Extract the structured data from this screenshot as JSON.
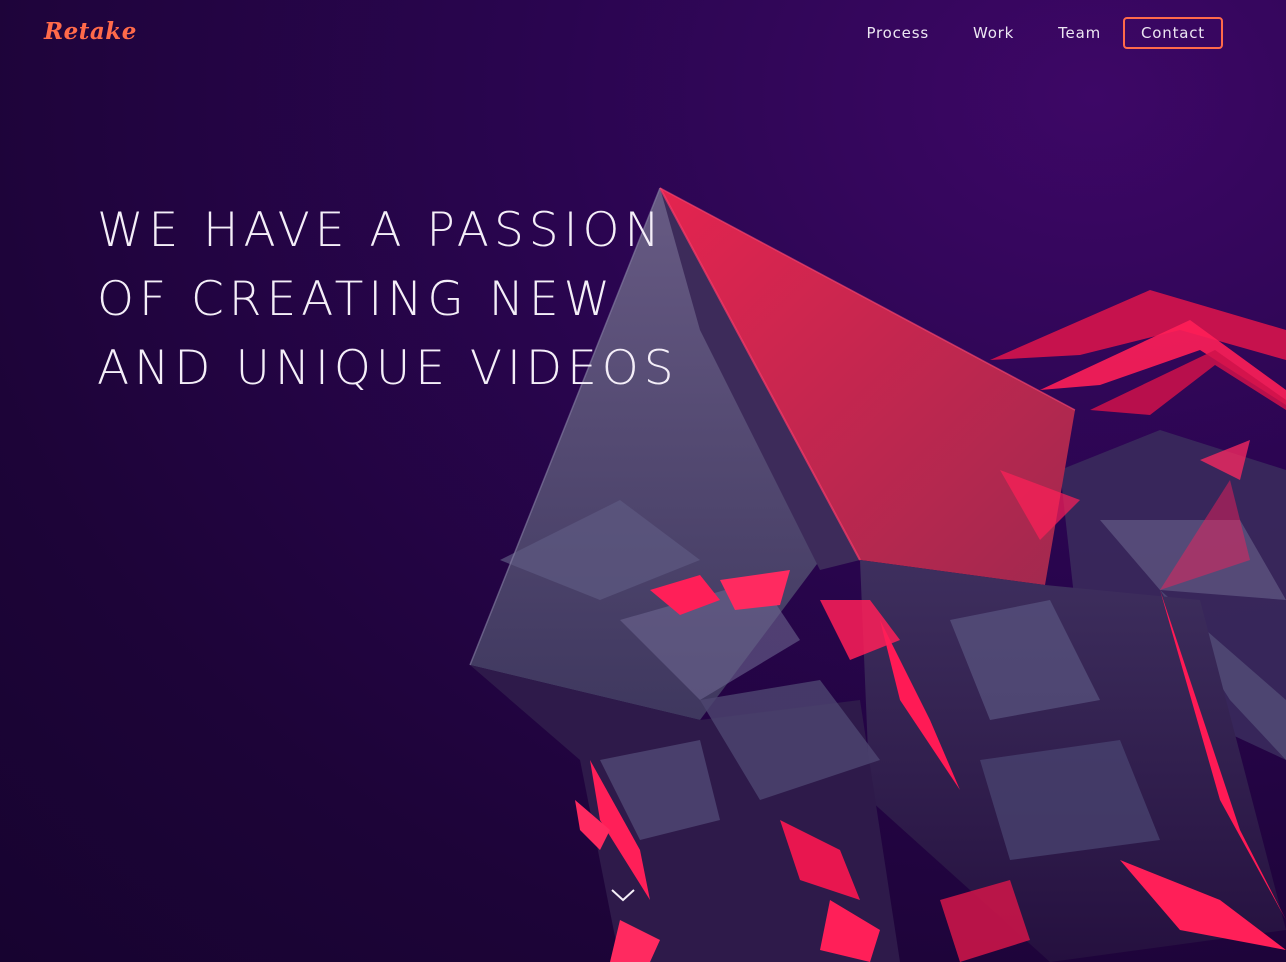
{
  "brand": {
    "logo_text": "Retake",
    "accent_color": "#ff6a4a"
  },
  "nav": {
    "items": [
      {
        "label": "Process"
      },
      {
        "label": "Work"
      },
      {
        "label": "Team"
      }
    ],
    "contact_label": "Contact"
  },
  "hero": {
    "lines": [
      "WE HAVE A PASSION",
      "OF CREATING NEW",
      "AND UNIQUE VIDEOS"
    ]
  },
  "scroll": {
    "icon": "chevron-down-icon"
  },
  "colors": {
    "background": "#24063f",
    "crystal_red": "#ff1a55",
    "crystal_slate": "#5b5a7e"
  }
}
